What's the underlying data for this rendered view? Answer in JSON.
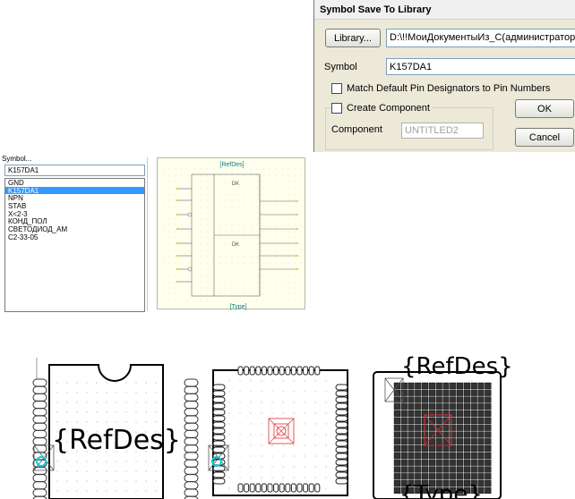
{
  "dialog": {
    "title": "Symbol Save To Library",
    "library_button": "Library...",
    "library_path": "D:\\!!МоиДокументыИз_С(администратор)\\!Мо",
    "symbol_label": "Symbol",
    "symbol_value": "K157DA1",
    "match_checkbox_label": "Match Default Pin Designators to Pin Numbers",
    "create_component_label": "Create Component",
    "component_label": "Component",
    "component_value": "UNTITLED2",
    "ok_button": "OK",
    "cancel_button": "Cancel"
  },
  "browser": {
    "symbol_label": "Symbol...",
    "symbol_value": "K157DA1",
    "items": [
      "GND",
      "K157DA1",
      "NPN",
      "STAB",
      "X<2-3",
      "КОНД_ПОЛ",
      "СВЕТОДИОД_АМ",
      "C2-33-05"
    ],
    "selected_index": 1
  },
  "preview": {
    "refdes": "[RefDes]",
    "type": "[Type]",
    "unit_top": "DK",
    "unit_bottom": "DK"
  },
  "footprints": {
    "refdes_large": "{RefDes}",
    "refdes_top": "{RefDes}",
    "type_bottom": "{Type}"
  },
  "colors": {
    "selection": "#3399ff",
    "pin_yellow": "#e6d400",
    "label_teal": "#008080",
    "footprint_red": "#e03030",
    "marker_cyan": "#00d0e0"
  }
}
